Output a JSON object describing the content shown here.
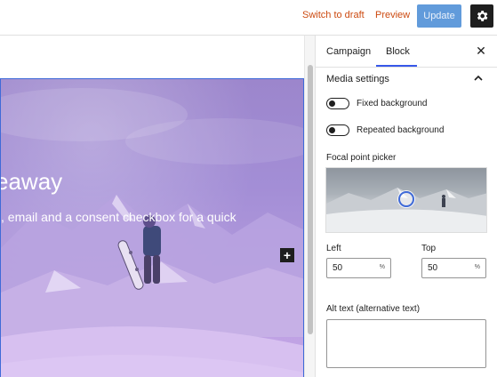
{
  "topbar": {
    "switch_to_draft": "Switch to draft",
    "preview": "Preview",
    "update": "Update",
    "settings_icon": "gear-icon"
  },
  "canvas": {
    "headline": "eaway",
    "subtext": ", email and a consent checkbox for a quick",
    "add_block_icon": "plus-icon",
    "add_block_label": "+"
  },
  "sidebar": {
    "tabs": [
      {
        "label": "Campaign",
        "active": false
      },
      {
        "label": "Block",
        "active": true
      }
    ],
    "close_icon": "close-icon",
    "close_label": "✕",
    "section_title": "Media settings",
    "toggles": [
      {
        "label": "Fixed background",
        "on": false
      },
      {
        "label": "Repeated background",
        "on": false
      }
    ],
    "focal_point": {
      "label": "Focal point picker",
      "left_label": "Left",
      "left_value": "50",
      "left_unit": "%",
      "top_label": "Top",
      "top_value": "50",
      "top_unit": "%"
    },
    "alt_text": {
      "label": "Alt text (alternative text)",
      "value": ""
    }
  },
  "colors": {
    "accent": "#3858e9",
    "link_orange": "#cc4a10",
    "update_blue": "#3f86d4",
    "overlay_purple": "#a38ed6"
  }
}
